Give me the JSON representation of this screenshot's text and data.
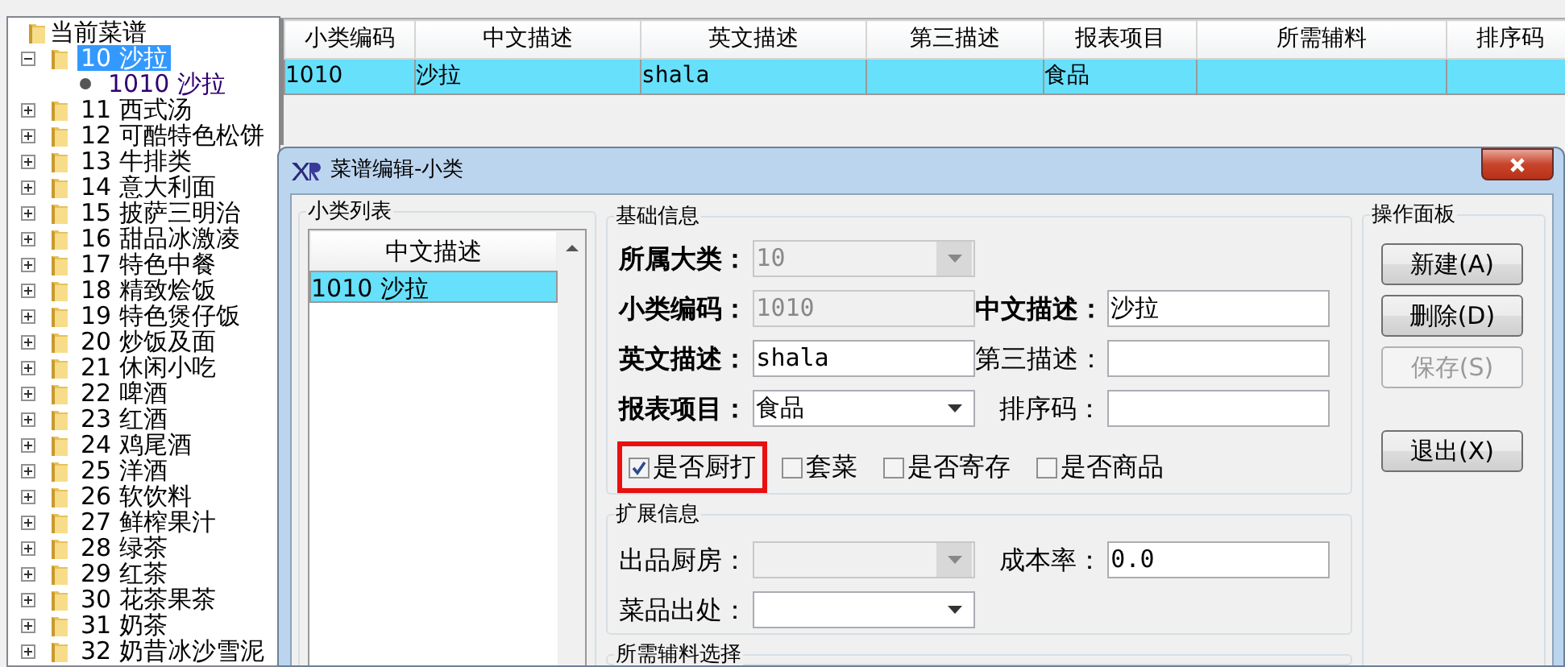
{
  "tree": {
    "root": "当前菜谱",
    "children": [
      {
        "label": "10 沙拉",
        "expanded": true,
        "selected": true,
        "children": [
          {
            "label": "1010 沙拉"
          }
        ]
      },
      {
        "label": "11 西式汤",
        "expanded": false,
        "selected": false
      },
      {
        "label": "12 可酷特色松饼",
        "expanded": false,
        "selected": false
      },
      {
        "label": "13 牛排类",
        "expanded": false,
        "selected": false
      },
      {
        "label": "14 意大利面",
        "expanded": false,
        "selected": false
      },
      {
        "label": "15 披萨三明治",
        "expanded": false,
        "selected": false
      },
      {
        "label": "16 甜品冰激凌",
        "expanded": false,
        "selected": false
      },
      {
        "label": "17 特色中餐",
        "expanded": false,
        "selected": false
      },
      {
        "label": "18 精致烩饭",
        "expanded": false,
        "selected": false
      },
      {
        "label": "19 特色煲仔饭",
        "expanded": false,
        "selected": false
      },
      {
        "label": "20 炒饭及面",
        "expanded": false,
        "selected": false
      },
      {
        "label": "21 休闲小吃",
        "expanded": false,
        "selected": false
      },
      {
        "label": "22 啤酒",
        "expanded": false,
        "selected": false
      },
      {
        "label": "23 红酒",
        "expanded": false,
        "selected": false
      },
      {
        "label": "24 鸡尾酒",
        "expanded": false,
        "selected": false
      },
      {
        "label": "25 洋酒",
        "expanded": false,
        "selected": false
      },
      {
        "label": "26 软饮料",
        "expanded": false,
        "selected": false
      },
      {
        "label": "27 鲜榨果汁",
        "expanded": false,
        "selected": false
      },
      {
        "label": "28 绿茶",
        "expanded": false,
        "selected": false
      },
      {
        "label": "29 红茶",
        "expanded": false,
        "selected": false
      },
      {
        "label": "30 花茶果茶",
        "expanded": false,
        "selected": false
      },
      {
        "label": "31 奶茶",
        "expanded": false,
        "selected": false
      },
      {
        "label": "32 奶昔冰沙雪泥",
        "expanded": false,
        "selected": false
      }
    ]
  },
  "grid": {
    "columns": [
      "小类编码",
      "中文描述",
      "英文描述",
      "第三描述",
      "报表项目",
      "所需辅料",
      "排序码"
    ],
    "rows": [
      {
        "selected": true,
        "cells": [
          "1010",
          "沙拉",
          "shala",
          "",
          "食品",
          "",
          ""
        ]
      }
    ]
  },
  "dialog": {
    "title": "菜谱编辑-小类",
    "list_panel": {
      "legend": "小类列表",
      "column": "中文描述",
      "items": [
        {
          "label": "1010 沙拉",
          "selected": true
        }
      ]
    },
    "basic": {
      "legend": "基础信息",
      "rows": [
        [
          {
            "label": "所属大类：",
            "value": "10",
            "kind": "combo",
            "required": true,
            "disabled": true
          }
        ],
        [
          {
            "label": "小类编码：",
            "value": "1010",
            "kind": "text",
            "required": true,
            "disabled": true
          },
          {
            "label": "中文描述：",
            "value": "沙拉",
            "kind": "text",
            "required": true,
            "disabled": false
          }
        ],
        [
          {
            "label": "英文描述：",
            "value": "shala",
            "kind": "text",
            "required": true,
            "disabled": false
          },
          {
            "label": "第三描述：",
            "kind": "text",
            "required": false,
            "disabled": false
          }
        ],
        [
          {
            "label": "报表项目：",
            "value": "食品",
            "kind": "combo",
            "required": true,
            "disabled": false
          },
          {
            "label": "排序码：",
            "kind": "text",
            "required": false,
            "disabled": false
          }
        ]
      ],
      "checkboxes": [
        {
          "label": "是否厨打",
          "checked": true,
          "highlighted": true
        },
        {
          "label": "套菜",
          "checked": false,
          "highlighted": false
        },
        {
          "label": "是否寄存",
          "checked": false,
          "highlighted": false
        },
        {
          "label": "是否商品",
          "checked": false,
          "highlighted": false
        }
      ]
    },
    "extended": {
      "legend": "扩展信息",
      "rows": [
        [
          {
            "label": "出品厨房：",
            "kind": "combo",
            "required": false,
            "disabled": true
          },
          {
            "label": "成本率：",
            "value": "0.0",
            "kind": "text",
            "required": false,
            "disabled": false
          }
        ],
        [
          {
            "label": "菜品出处：",
            "kind": "combo",
            "required": false,
            "disabled": false
          }
        ]
      ]
    },
    "actions": {
      "legend": "操作面板",
      "button_groups": [
        [
          {
            "label": "新建(A)",
            "disabled": false
          },
          {
            "label": "删除(D)",
            "disabled": false
          },
          {
            "label": "保存(S)",
            "disabled": true
          }
        ],
        [
          {
            "label": "退出(X)",
            "disabled": false
          }
        ]
      ]
    },
    "bottom_legend": "所需辅料选择"
  }
}
